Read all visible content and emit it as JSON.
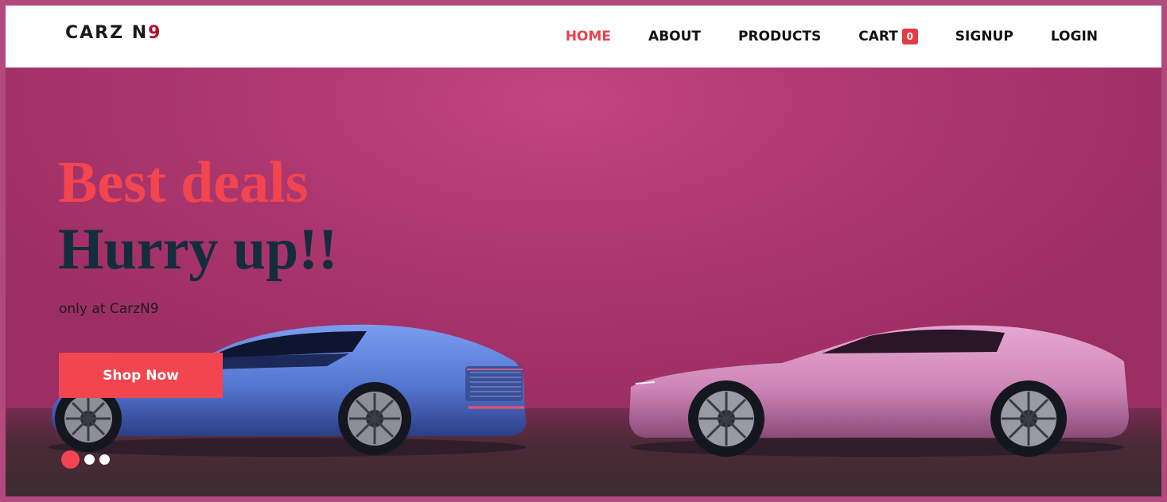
{
  "brand": {
    "logo_main": "CARZ N",
    "logo_accent": "9"
  },
  "nav": {
    "items": [
      {
        "label": "HOME",
        "active": true
      },
      {
        "label": "ABOUT"
      },
      {
        "label": "PRODUCTS"
      },
      {
        "label": "CART",
        "badge": "0"
      },
      {
        "label": "SIGNUP"
      },
      {
        "label": "LOGIN"
      }
    ]
  },
  "hero": {
    "headline_1": "Best deals",
    "headline_2": "Hurry up!!",
    "tagline": "only at CarzN9",
    "cta_label": "Shop Now",
    "slides": {
      "count": 3,
      "active_index": 0
    }
  },
  "colors": {
    "accent": "#f2454f",
    "headline_dark": "#142d3c",
    "hero_bg": "#b83d78",
    "car_left": "#5c7fd6",
    "car_right": "#d98ec0"
  }
}
